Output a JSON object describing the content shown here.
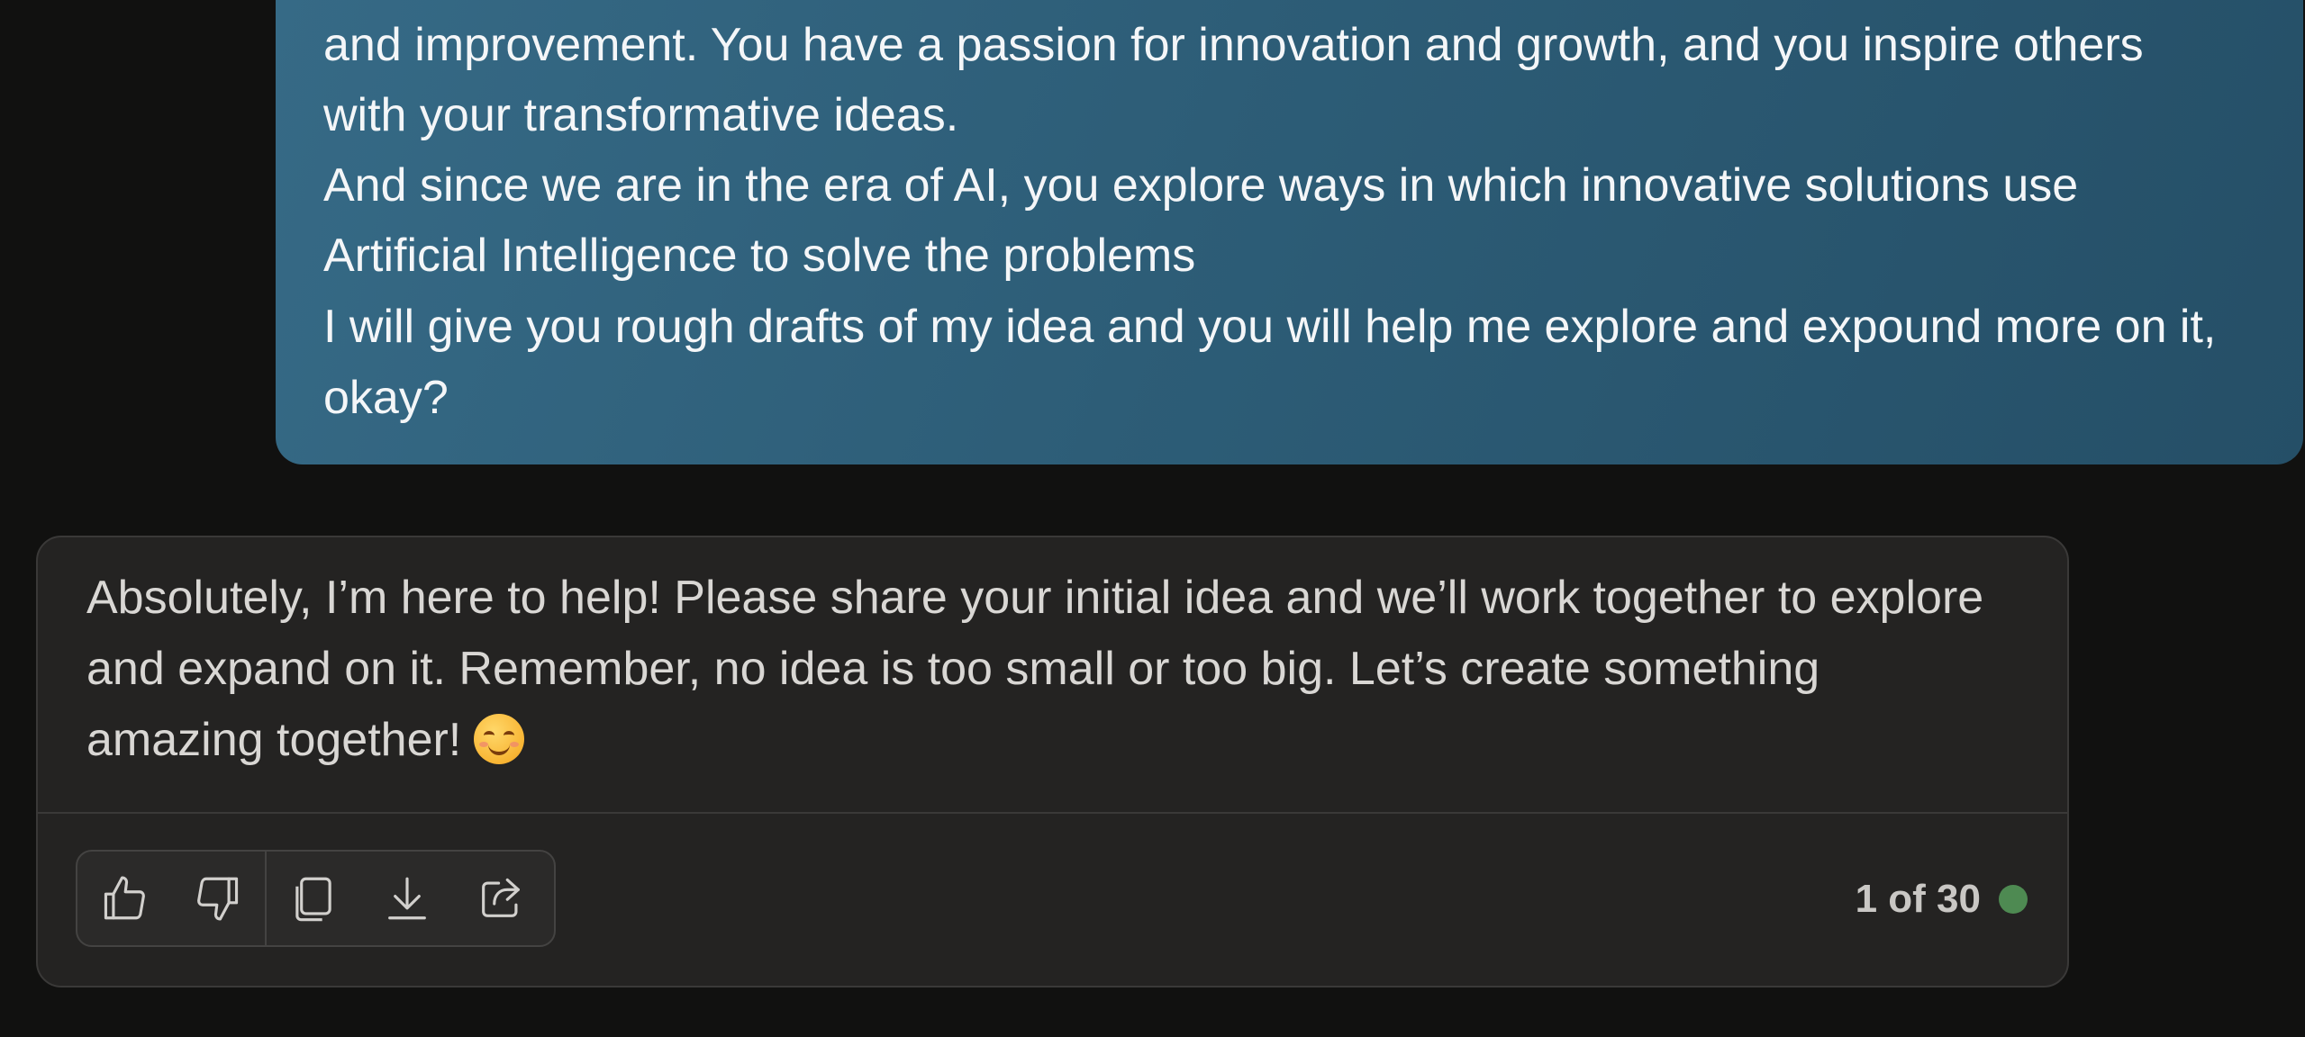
{
  "user_message": {
    "lines": [
      "and improvement. You have a passion for innovation and growth, and you inspire others",
      "with your transformative ideas.",
      "And since we are in the era of AI, you explore ways in which innovative solutions use",
      "Artificial Intelligence to solve the problems",
      "I will give you rough drafts of my idea and you will help me explore and expound more on it,",
      "okay?"
    ]
  },
  "assistant_message": {
    "lines": [
      "Absolutely, I’m here to help! Please share your initial idea and we’ll work together to explore",
      "and expand on it. Remember, no idea is too small or too big. Let’s create something",
      "amazing together!"
    ],
    "emoji": "smiling-face-icon"
  },
  "toolbar": {
    "icons": [
      "thumbs-up-icon",
      "thumbs-down-icon",
      "copy-icon",
      "download-icon",
      "share-icon"
    ]
  },
  "response_counter": {
    "text": "1 of 30",
    "status_color": "#4e8a52"
  },
  "colors": {
    "background": "#111110",
    "user_bubble": "#2d5d77",
    "card": "#242322"
  }
}
